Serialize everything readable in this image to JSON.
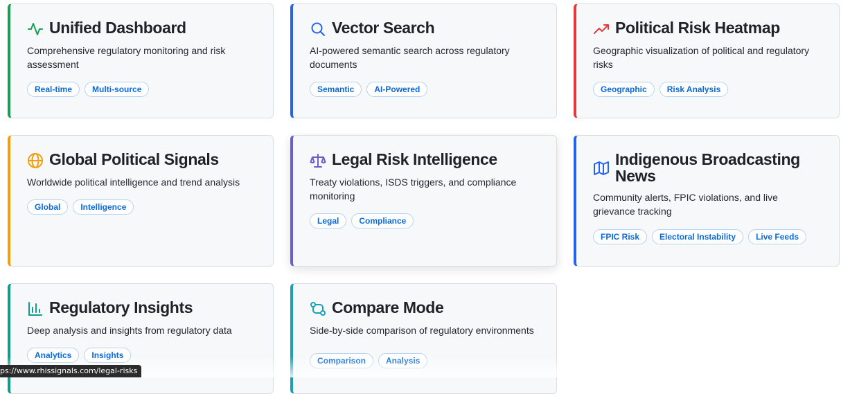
{
  "cards": [
    {
      "title": "Unified Dashboard",
      "description": "Comprehensive regulatory monitoring and risk assessment",
      "tags": [
        "Real-time",
        "Multi-source"
      ],
      "accent": "#1a9e52",
      "icon": "activity-icon"
    },
    {
      "title": "Vector Search",
      "description": "AI-powered semantic search across regulatory documents",
      "tags": [
        "Semantic",
        "AI-Powered"
      ],
      "accent": "#2563eb",
      "icon": "search-icon"
    },
    {
      "title": "Political Risk Heatmap",
      "description": "Geographic visualization of political and regulatory risks",
      "tags": [
        "Geographic",
        "Risk Analysis"
      ],
      "accent": "#e5383b",
      "icon": "trending-up-icon"
    },
    {
      "title": "Global Political Signals",
      "description": "Worldwide political intelligence and trend analysis",
      "tags": [
        "Global",
        "Intelligence"
      ],
      "accent": "#f59e0b",
      "icon": "globe-icon"
    },
    {
      "title": "Legal Risk Intelligence",
      "description": "Treaty violations, ISDS triggers, and compliance monitoring",
      "tags": [
        "Legal",
        "Compliance"
      ],
      "accent": "#6d5bd0",
      "icon": "scale-icon"
    },
    {
      "title": "Indigenous Broadcasting News",
      "description": "Community alerts, FPIC violations, and live grievance tracking",
      "tags": [
        "FPIC Risk",
        "Electoral Instability",
        "Live Feeds"
      ],
      "accent": "#2563eb",
      "icon": "map-icon"
    },
    {
      "title": "Regulatory Insights",
      "description": "Deep analysis and insights from regulatory data",
      "tags": [
        "Analytics",
        "Insights"
      ],
      "accent": "#0f9d8a",
      "icon": "bar-chart-icon"
    },
    {
      "title": "Compare Mode",
      "description": "Side-by-side comparison of regulatory environments",
      "tags": [
        "Comparison",
        "Analysis"
      ],
      "accent": "#17a2b8",
      "icon": "git-compare-icon"
    }
  ],
  "status_bar": {
    "url": "ps://www.rhissignals.com/legal-risks"
  }
}
